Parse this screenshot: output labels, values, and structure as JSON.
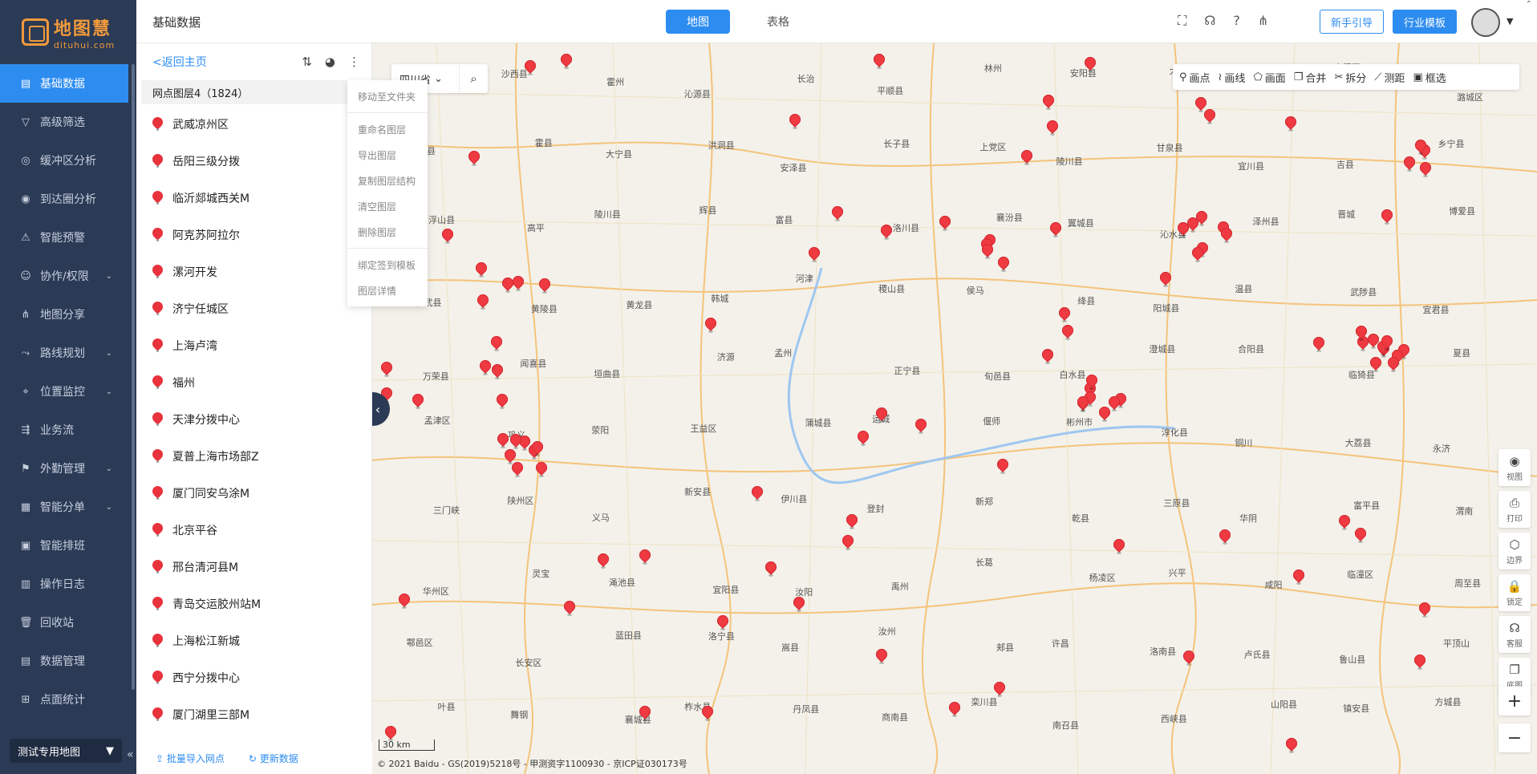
{
  "brand": {
    "name_cn": "地图慧",
    "name_en": "dituhui.com"
  },
  "sidebar": {
    "items": [
      {
        "label": "基础数据",
        "icon": "table-icon",
        "active": true,
        "expandable": false
      },
      {
        "label": "高级筛选",
        "icon": "filter-icon",
        "active": false,
        "expandable": false
      },
      {
        "label": "缓冲区分析",
        "icon": "buffer-icon",
        "active": false,
        "expandable": false
      },
      {
        "label": "到达圈分析",
        "icon": "target-icon",
        "active": false,
        "expandable": false
      },
      {
        "label": "智能预警",
        "icon": "alert-icon",
        "active": false,
        "expandable": false
      },
      {
        "label": "协作/权限",
        "icon": "user-icon",
        "active": false,
        "expandable": true
      },
      {
        "label": "地图分享",
        "icon": "share-icon",
        "active": false,
        "expandable": false
      },
      {
        "label": "路线规划",
        "icon": "route-icon",
        "active": false,
        "expandable": true
      },
      {
        "label": "位置监控",
        "icon": "location-icon",
        "active": false,
        "expandable": true
      },
      {
        "label": "业务流",
        "icon": "flow-icon",
        "active": false,
        "expandable": false
      },
      {
        "label": "外勤管理",
        "icon": "field-icon",
        "active": false,
        "expandable": true
      },
      {
        "label": "智能分单",
        "icon": "dispatch-icon",
        "active": false,
        "expandable": true
      },
      {
        "label": "智能排班",
        "icon": "schedule-icon",
        "active": false,
        "expandable": false
      },
      {
        "label": "操作日志",
        "icon": "log-icon",
        "active": false,
        "expandable": false
      },
      {
        "label": "回收站",
        "icon": "trash-icon",
        "active": false,
        "expandable": false
      },
      {
        "label": "数据管理",
        "icon": "data-icon",
        "active": false,
        "expandable": false
      },
      {
        "label": "点面统计",
        "icon": "stats-icon",
        "active": false,
        "expandable": false
      }
    ],
    "map_select": "测试专用地图"
  },
  "header": {
    "title": "基础数据",
    "tabs": [
      {
        "label": "地图",
        "active": true
      },
      {
        "label": "表格",
        "active": false
      }
    ],
    "guide_button": "新手引导",
    "template_button": "行业模板"
  },
  "panel": {
    "back_label": "<返回主页",
    "layer_title": "网点图层4（1824）",
    "items": [
      "武威凉州区",
      "岳阳三级分拨",
      "临沂郯城西关M",
      "阿克苏阿拉尔",
      "漯河开发",
      "济宁任城区",
      "上海卢湾",
      "福州",
      "天津分拨中心",
      "夏普上海市场部Z",
      "厦门同安乌涂M",
      "北京平谷",
      "邢台清河县M",
      "青岛交运胶州站M",
      "上海松江新城",
      "西宁分拨中心",
      "厦门湖里三部M"
    ],
    "import_label": "批量导入网点",
    "refresh_label": "更新数据"
  },
  "context_menu": {
    "items": [
      "移动至文件夹",
      "重命名图层",
      "导出图层",
      "复制图层结构",
      "清空图层",
      "删除图层",
      "绑定签到模板",
      "图层详情"
    ]
  },
  "map": {
    "region": "四川省",
    "draw_tools": [
      "画点",
      "画线",
      "画面",
      "合并",
      "拆分",
      "测距",
      "框选"
    ],
    "side_tools": [
      "视图",
      "打印",
      "边界",
      "锁定",
      "客服",
      "底图"
    ],
    "scale": "30 km",
    "copyright": "© 2021 Baidu - GS(2019)5218号 - 甲测资字1100930 - 京ICP证030173号",
    "labels": [
      "延长县",
      "沙西县",
      "霍州",
      "沁源县",
      "长治",
      "平顺县",
      "林州",
      "安阳县",
      "大宁县",
      "古县",
      "屯留区",
      "潞城区",
      "壶关县",
      "霍县",
      "大宁县",
      "洪洞县",
      "安泽县",
      "长子县",
      "上党区",
      "陵川县",
      "甘泉县",
      "宜川县",
      "吉县",
      "乡宁县",
      "浮山县",
      "高平",
      "陵川县",
      "辉县",
      "富县",
      "洛川县",
      "襄汾县",
      "翼城县",
      "沁水县",
      "泽州县",
      "晋城",
      "博爱县",
      "修武县",
      "黄陵县",
      "黄龙县",
      "韩城",
      "河津",
      "稷山县",
      "侯马",
      "绛县",
      "阳城县",
      "温县",
      "武陟县",
      "宜君县",
      "万荣县",
      "闻喜县",
      "垣曲县",
      "济源",
      "孟州",
      "正宁县",
      "旬邑县",
      "白水县",
      "澄城县",
      "合阳县",
      "临猗县",
      "夏县",
      "孟津区",
      "巩义",
      "荥阳",
      "王益区",
      "蒲城县",
      "运城",
      "偃师",
      "彬州市",
      "淳化县",
      "铜川",
      "大荔县",
      "永济",
      "三门峡",
      "陕州区",
      "义马",
      "新安县",
      "伊川县",
      "登封",
      "新郑",
      "乾县",
      "三原县",
      "华阴",
      "富平县",
      "渭南",
      "华州区",
      "灵宝",
      "渑池县",
      "宜阳县",
      "汝阳",
      "禹州",
      "长葛",
      "杨凌区",
      "兴平",
      "咸阳",
      "临潼区",
      "周至县",
      "鄠邑区",
      "长安区",
      "蓝田县",
      "洛宁县",
      "嵩县",
      "汝州",
      "郏县",
      "许昌",
      "洛南县",
      "卢氏县",
      "鲁山县",
      "平顶山",
      "叶县",
      "舞钢",
      "襄城县",
      "柞水县",
      "丹凤县",
      "商南县",
      "栾川县",
      "南召县",
      "西峡县",
      "山阳县",
      "镇安县",
      "方城县",
      "舞阳",
      "临颍县"
    ]
  }
}
